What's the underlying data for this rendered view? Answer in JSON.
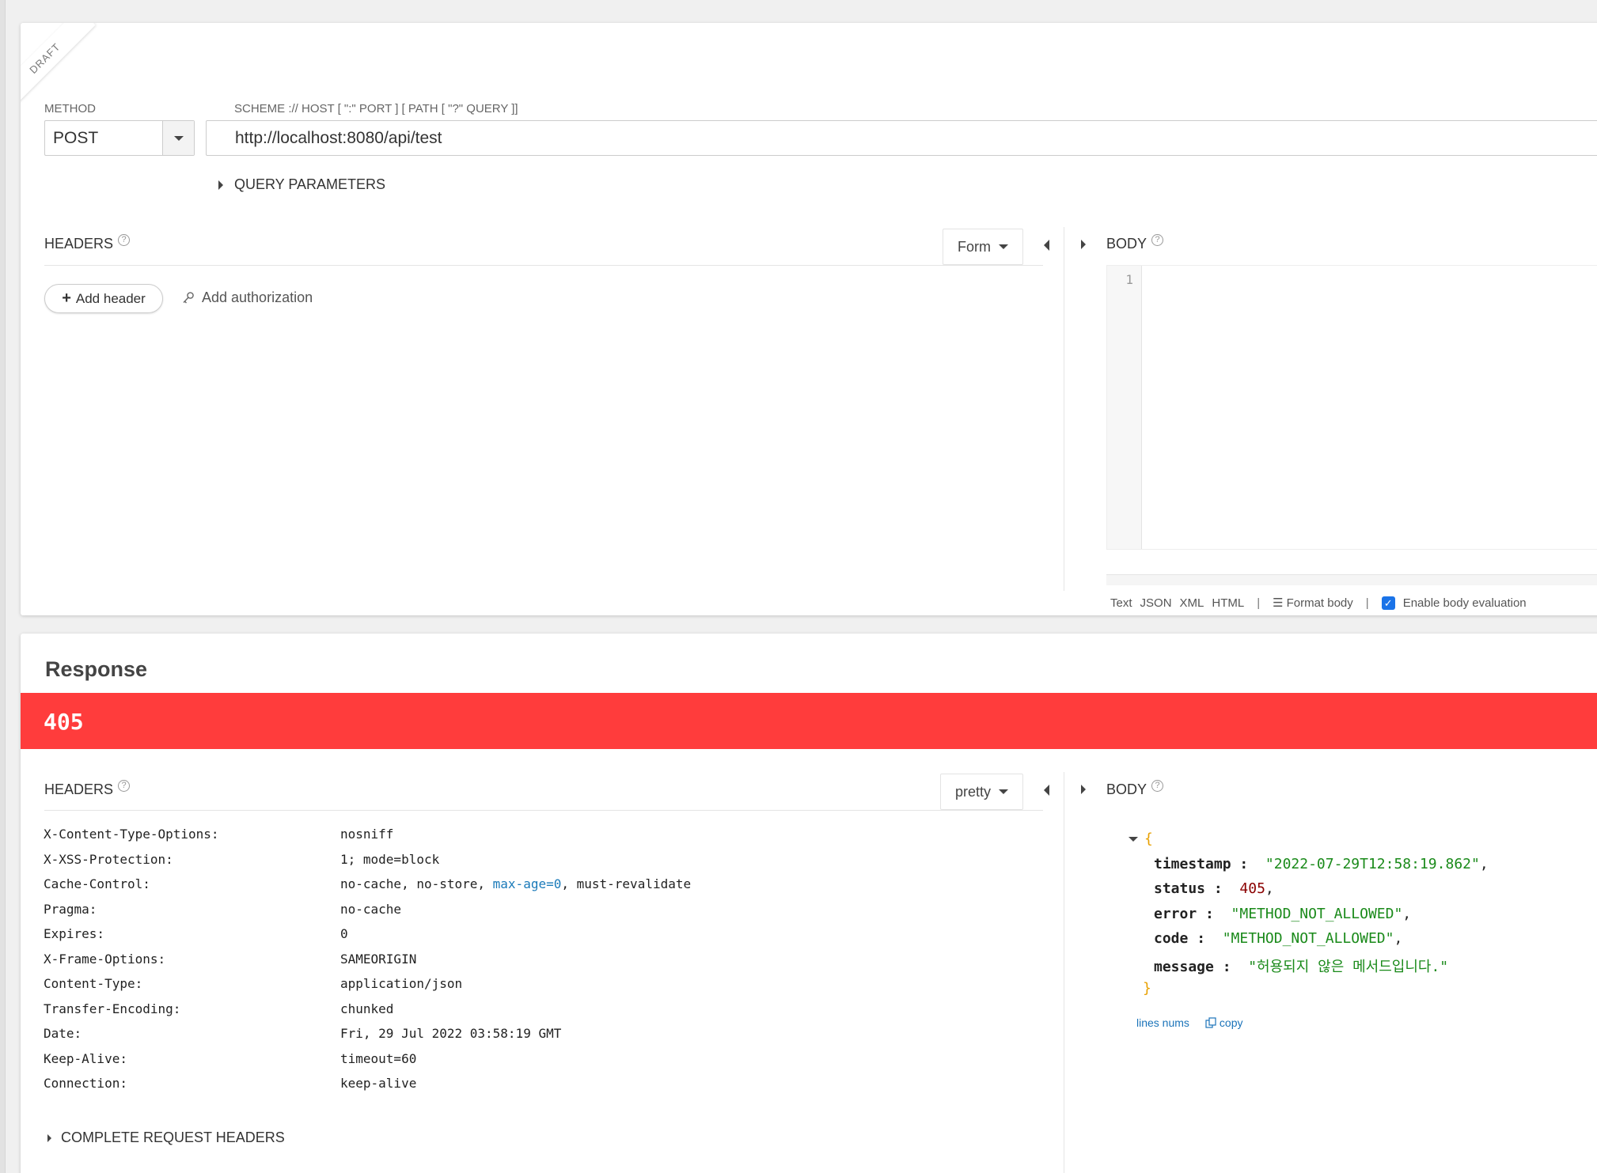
{
  "request": {
    "draft_label": "DRAFT",
    "method_label": "METHOD",
    "method_value": "POST",
    "url_label": "SCHEME :// HOST [ \":\" PORT ] [ PATH [ \"?\" QUERY ]]",
    "url_value": "http://localhost:8080/api/test",
    "query_params_label": "QUERY PARAMETERS",
    "headers_title": "HEADERS",
    "headers_mode": "Form",
    "add_header_label": "Add header",
    "add_auth_label": "Add authorization",
    "body_title": "BODY",
    "editor_line_numbers": [
      "1"
    ],
    "body_formats": [
      "Text",
      "JSON",
      "XML",
      "HTML"
    ],
    "format_body_label": "Format body",
    "enable_eval_label": "Enable body evaluation",
    "enable_eval_checked": true
  },
  "response": {
    "title": "Response",
    "status_code": "405",
    "status_color": "#ff3c3c",
    "headers_title": "HEADERS",
    "headers_mode": "pretty",
    "headers": [
      {
        "key": "X-Content-Type-Options:",
        "value": "nosniff"
      },
      {
        "key": "X-XSS-Protection:",
        "value": "1; mode=block"
      },
      {
        "key": "Cache-Control:",
        "value_parts": [
          "no-cache, no-store, ",
          "max-age=0",
          ", must-revalidate"
        ]
      },
      {
        "key": "Pragma:",
        "value": "no-cache"
      },
      {
        "key": "Expires:",
        "value": "0"
      },
      {
        "key": "X-Frame-Options:",
        "value": "SAMEORIGIN"
      },
      {
        "key": "Content-Type:",
        "value": "application/json"
      },
      {
        "key": "Transfer-Encoding:",
        "value": "chunked"
      },
      {
        "key": "Date:",
        "value": "Fri, 29 Jul 2022 03:58:19 GMT"
      },
      {
        "key": "Keep-Alive:",
        "value": "timeout=60"
      },
      {
        "key": "Connection:",
        "value": "keep-alive"
      }
    ],
    "complete_request_headers_label": "COMPLETE REQUEST HEADERS",
    "body_title": "BODY",
    "json": {
      "open_brace": "{",
      "close_brace": "}",
      "fields": [
        {
          "key": "timestamp",
          "value": "\"2022-07-29T12:58:19.862\"",
          "kind": "string",
          "comma": ","
        },
        {
          "key": "status",
          "value": "405",
          "kind": "number",
          "comma": ","
        },
        {
          "key": "error",
          "value": "\"METHOD_NOT_ALLOWED\"",
          "kind": "string",
          "comma": ","
        },
        {
          "key": "code",
          "value": "\"METHOD_NOT_ALLOWED\"",
          "kind": "string",
          "comma": ","
        },
        {
          "key": "message",
          "value": "\"허용되지 않은 메서드입니다.\"",
          "kind": "string",
          "comma": ""
        }
      ]
    },
    "lines_nums_label": "lines nums",
    "copy_label": "copy"
  }
}
